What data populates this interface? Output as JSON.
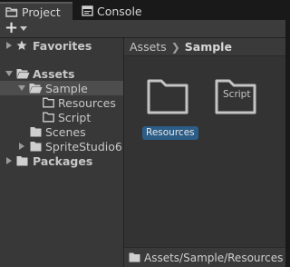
{
  "tabs": [
    {
      "label": "Project",
      "icon": "folder-tab-icon",
      "active": true
    },
    {
      "label": "Console",
      "icon": "console-icon",
      "active": false
    }
  ],
  "toolbar": {
    "create_label": "+",
    "create_icon": "plus-icon"
  },
  "tree": {
    "favorites": "Favorites",
    "assets": "Assets",
    "sample": "Sample",
    "resources": "Resources",
    "script": "Script",
    "scenes": "Scenes",
    "spritestudio": "SpriteStudio6",
    "packages": "Packages"
  },
  "breadcrumb": {
    "root": "Assets",
    "current": "Sample"
  },
  "grid": [
    {
      "label": "Resources",
      "selected": true
    },
    {
      "label": "Script",
      "selected": false
    }
  ],
  "statusbar": {
    "path": "Assets/Sample/Resources"
  },
  "colors": {
    "selection": "#2c5d87",
    "panel": "#383838",
    "content": "#333333"
  }
}
